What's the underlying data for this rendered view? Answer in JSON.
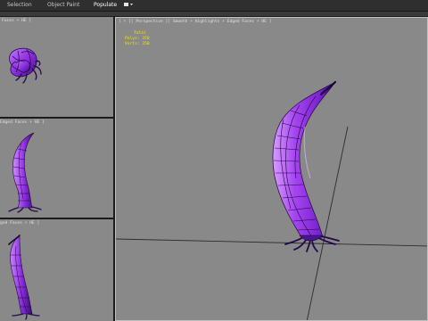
{
  "ribbon": {
    "tabs": [
      {
        "label": "Selection"
      },
      {
        "label": "Object Paint"
      },
      {
        "label": "Populate"
      }
    ]
  },
  "viewports": {
    "top_left": {
      "label": "Faces + HE ]"
    },
    "mid_left": {
      "label": "Edged Faces + HE ]"
    },
    "bottom_left": {
      "label": "ged Faces + HE ]"
    },
    "main": {
      "label": "[ + ][ Perspective ][ Smooth + Highlights + Edged Faces + HE ]",
      "stats": {
        "heading": "Total",
        "polys_label": "Polys:",
        "polys_value": "350",
        "verts_label": "Verts:",
        "verts_value": "350"
      }
    }
  },
  "colors": {
    "viewport_bg": "#898989",
    "mesh_purple": "#8e2fe0",
    "mesh_dark": "#1a0636",
    "stats_yellow": "#f2e600"
  }
}
